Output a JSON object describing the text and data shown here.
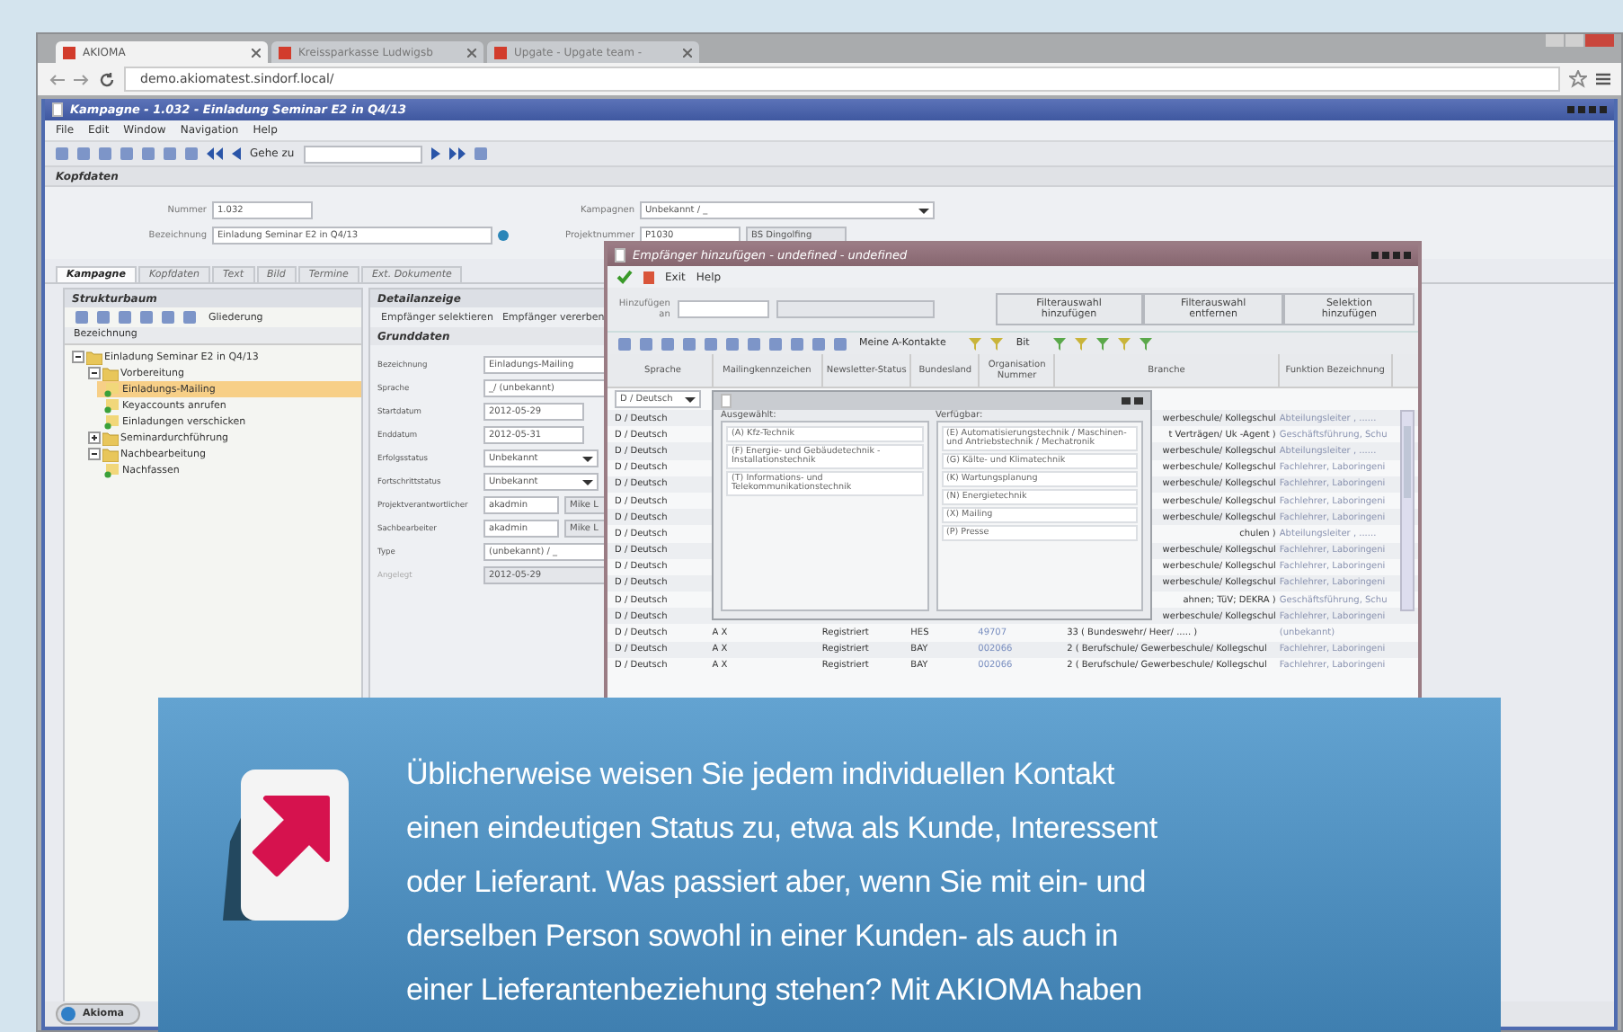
{
  "browser": {
    "tabs": [
      {
        "label": "AKIOMA",
        "selected": true
      },
      {
        "label": "Kreissparkasse Ludwigsb",
        "selected": false
      },
      {
        "label": "Upgate - Upgate team -",
        "selected": false
      }
    ],
    "url": "demo.akiomatest.sindorf.local/"
  },
  "app": {
    "title": "Kampagne - 1.032 - Einladung Seminar E2 in Q4/13",
    "menu": [
      "File",
      "Edit",
      "Window",
      "Navigation",
      "Help"
    ],
    "goto_label": "Gehe zu",
    "header": {
      "title": "Kopfdaten",
      "number_label": "Nummer",
      "number": "1.032",
      "name_label": "Bezeichnung",
      "name": "Einladung Seminar E2 in Q4/13",
      "campaign_label": "Kampagnen",
      "campaign": "Unbekannt / _",
      "project_label": "Projektnummer",
      "project": "P1030",
      "project_name": "BS Dingolfing"
    },
    "tabs": [
      {
        "label": "Kampagne",
        "selected": true
      },
      {
        "label": "Kopfdaten",
        "selected": false
      },
      {
        "label": "Text",
        "selected": false
      },
      {
        "label": "Bild",
        "selected": false
      },
      {
        "label": "Termine",
        "selected": false
      },
      {
        "label": "Ext. Dokumente",
        "selected": false
      }
    ],
    "tree": {
      "title": "Strukturbaum",
      "dropdown": "Gliederung",
      "column": "Bezeichnung",
      "items": [
        {
          "label": "Einladung Seminar E2 in Q4/13",
          "selected": false,
          "expanded": true,
          "children": [
            {
              "label": "Vorbereitung",
              "selected": false,
              "expanded": true,
              "children": [
                {
                  "label": "Einladungs-Mailing",
                  "selected": true
                },
                {
                  "label": "Keyaccounts anrufen",
                  "selected": false
                },
                {
                  "label": "Einladungen verschicken",
                  "selected": false
                }
              ]
            },
            {
              "label": "Seminardurchführung",
              "selected": false,
              "expanded": false
            },
            {
              "label": "Nachbearbeitung",
              "selected": false,
              "expanded": true,
              "children": [
                {
                  "label": "Nachfassen",
                  "selected": false
                }
              ]
            }
          ]
        }
      ]
    },
    "detail": {
      "title": "Detailanzeige",
      "actions": [
        "Empfänger selektieren",
        "Empfänger vererben"
      ],
      "section": "Grunddaten",
      "fields": [
        {
          "label": "Bezeichnung",
          "value": "Einladungs-Mailing",
          "kind": "wide"
        },
        {
          "label": "Sprache",
          "value": "_/ (unbekannt)",
          "kind": "wide"
        },
        {
          "label": "Startdatum",
          "value": "2012-05-29",
          "kind": "date"
        },
        {
          "label": "Enddatum",
          "value": "2012-05-31",
          "kind": "date"
        },
        {
          "label": "Erfolgsstatus",
          "value": "Unbekannt",
          "kind": "select"
        },
        {
          "label": "Fortschrittstatus",
          "value": "Unbekannt",
          "kind": "select"
        },
        {
          "label": "Projektverantwortlicher",
          "value": "akadmin",
          "kind": "lookup",
          "extra": "Mike L"
        },
        {
          "label": "Sachbearbeiter",
          "value": "akadmin",
          "kind": "lookup",
          "extra": "Mike L"
        },
        {
          "label": "Type",
          "value": "(unbekannt) / _",
          "kind": "wide"
        },
        {
          "label": "Angelegt",
          "value": "2012-05-29",
          "kind": "readonly"
        }
      ]
    }
  },
  "dialog": {
    "title": "Empfänger hinzufügen - undefined - undefined",
    "menu": [
      "Exit",
      "Help"
    ],
    "add_to_label": "Hinzufügen an",
    "buttons": [
      "Filterauswahl hinzufügen",
      "Filterauswahl entfernen",
      "Selektion hinzufügen"
    ],
    "view": "Meine A-Kontakte",
    "view2": "Bit",
    "columns": [
      "Sprache",
      "Mailingkennzeichen",
      "Newsletter-Status",
      "Bundesland",
      "Organisation Nummer",
      "Branche",
      "Funktion Bezeichnung"
    ],
    "filter_value": "D / Deutsch",
    "rows": [
      {
        "kind": "partial",
        "sprache": "D / Deutsch",
        "branche": "werbeschule/ Kollegschul",
        "funktion": "Abteilungsleiter , ......"
      },
      {
        "kind": "partial",
        "sprache": "D / Deutsch",
        "branche": "t Verträgen/ Uk -Agent )",
        "funktion": "Geschäftsführung, Schu"
      },
      {
        "kind": "partial",
        "sprache": "D / Deutsch",
        "branche": "werbeschule/ Kollegschul",
        "funktion": "Abteilungsleiter , ......"
      },
      {
        "kind": "partial",
        "sprache": "D / Deutsch",
        "branche": "werbeschule/ Kollegschul",
        "funktion": "Fachlehrer, Laboringeni"
      },
      {
        "kind": "partial",
        "sprache": "D / Deutsch",
        "branche": "werbeschule/ Kollegschul",
        "funktion": "Fachlehrer, Laboringeni"
      },
      {
        "kind": "partial",
        "sprache": "D / Deutsch",
        "branche": "werbeschule/ Kollegschul",
        "funktion": "Fachlehrer, Laboringeni"
      },
      {
        "kind": "partial",
        "sprache": "D / Deutsch",
        "branche": "werbeschule/ Kollegschul",
        "funktion": "Fachlehrer, Laboringeni"
      },
      {
        "kind": "partial",
        "sprache": "D / Deutsch",
        "branche": "chulen )",
        "funktion": "Abteilungsleiter , ......"
      },
      {
        "kind": "partial",
        "sprache": "D / Deutsch",
        "branche": "werbeschule/ Kollegschul",
        "funktion": "Fachlehrer, Laboringeni"
      },
      {
        "kind": "partial",
        "sprache": "D / Deutsch",
        "branche": "werbeschule/ Kollegschul",
        "funktion": "Fachlehrer, Laboringeni"
      },
      {
        "kind": "partial",
        "sprache": "D / Deutsch",
        "branche": "werbeschule/ Kollegschul",
        "funktion": "Fachlehrer, Laboringeni"
      },
      {
        "kind": "partial",
        "sprache": "D / Deutsch",
        "branche": "ahnen; TüV; DEKRA )",
        "funktion": "Geschäftsführung, Schu"
      },
      {
        "kind": "partial",
        "sprache": "D / Deutsch",
        "branche": "werbeschule/ Kollegschul",
        "funktion": "Fachlehrer, Laboringeni"
      },
      {
        "kind": "full",
        "sprache": "D / Deutsch",
        "mailing": "A X",
        "newsletter": "Registriert",
        "bundesland": "HES",
        "organisation": "49707",
        "branche": "33 ( Bundeswehr/ Heer/ ..... )",
        "funktion": "(unbekannt)"
      },
      {
        "kind": "full",
        "sprache": "D / Deutsch",
        "mailing": "A X",
        "newsletter": "Registriert",
        "bundesland": "BAY",
        "organisation": "002066",
        "branche": "2 ( Berufschule/ Gewerbeschule/ Kollegschul",
        "funktion": "Fachlehrer, Laboringeni"
      },
      {
        "kind": "full",
        "sprache": "D / Deutsch",
        "mailing": "A X",
        "newsletter": "Registriert",
        "bundesland": "BAY",
        "organisation": "002066",
        "branche": "2 ( Berufschule/ Gewerbeschule/ Kollegschul",
        "funktion": "Fachlehrer, Laboringeni"
      }
    ],
    "picker": {
      "selected_label": "Ausgewählt:",
      "available_label": "Verfügbar:",
      "selected_items": [
        "(A) Kfz-Technik",
        "(F) Energie- und Gebäudetechnik - Installationstechnik",
        "(T) Informations- und Telekommunikationstechnik"
      ],
      "available_items": [
        "(E) Automatisierungstechnik / Maschinen- und Antriebstechnik / Mechatronik",
        "(G) Kälte- und Klimatechnik",
        "(K) Wartungsplanung",
        "(N) Energietechnik",
        "(X) Mailing",
        "(P) Presse"
      ]
    }
  },
  "taskbar": {
    "button": "Akioma"
  },
  "callout": {
    "text": "Üblicherweise weisen Sie jedem individuellen Kontakt einen eindeutigen Status zu, etwa als Kunde, Interessent oder Lieferant. Was passiert aber, wenn Sie mit ein- und derselben Person sowohl in einer Kunden- als auch in einer Lieferantenbeziehung stehen? Mit AKIOMA haben"
  }
}
